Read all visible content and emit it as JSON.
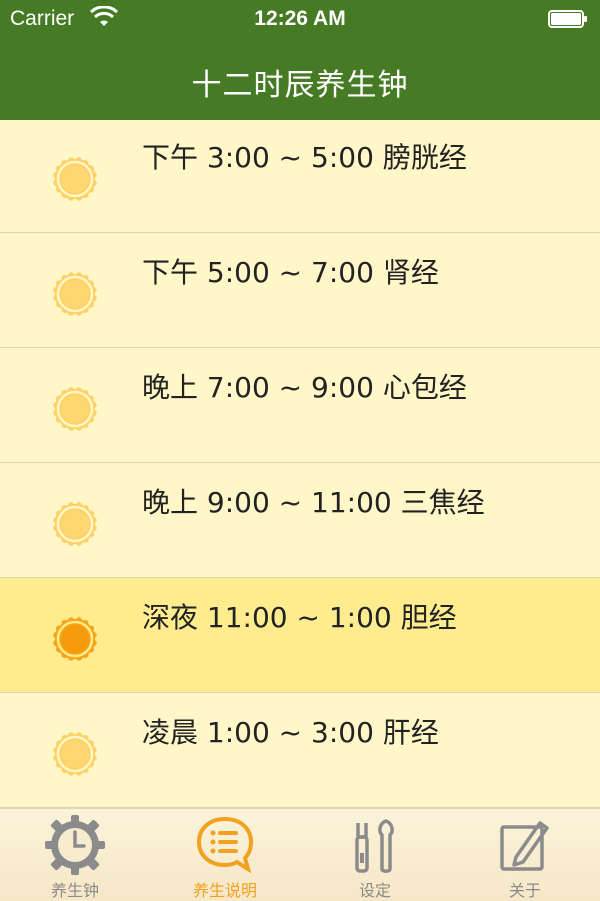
{
  "status_bar": {
    "carrier": "Carrier",
    "time": "12:26 AM"
  },
  "nav": {
    "title": "十二时辰养生钟"
  },
  "rows": [
    {
      "label": "下午 3:00 ~ 5:00  膀胱经",
      "active": false
    },
    {
      "label": "下午 5:00 ~ 7:00  肾经",
      "active": false
    },
    {
      "label": "晚上 7:00 ~ 9:00  心包经",
      "active": false
    },
    {
      "label": "晚上 9:00 ~ 11:00  三焦经",
      "active": false
    },
    {
      "label": "深夜 11:00 ~ 1:00  胆经",
      "active": true
    },
    {
      "label": "凌晨 1:00 ~ 3:00  肝经",
      "active": false
    }
  ],
  "tabs": [
    {
      "label": "养生钟",
      "icon": "clock-gear-icon",
      "selected": false
    },
    {
      "label": "养生说明",
      "icon": "speech-list-icon",
      "selected": true
    },
    {
      "label": "设定",
      "icon": "tools-icon",
      "selected": false
    },
    {
      "label": "关于",
      "icon": "notepad-pen-icon",
      "selected": false
    }
  ],
  "colors": {
    "nav": "#467a24",
    "row": "#fff7c8",
    "row_active": "#ffec8e",
    "sun": "#ffd166",
    "sun_active": "#f7a418",
    "tab_selected": "#f2a020",
    "tab_default": "#8b8b8b"
  }
}
